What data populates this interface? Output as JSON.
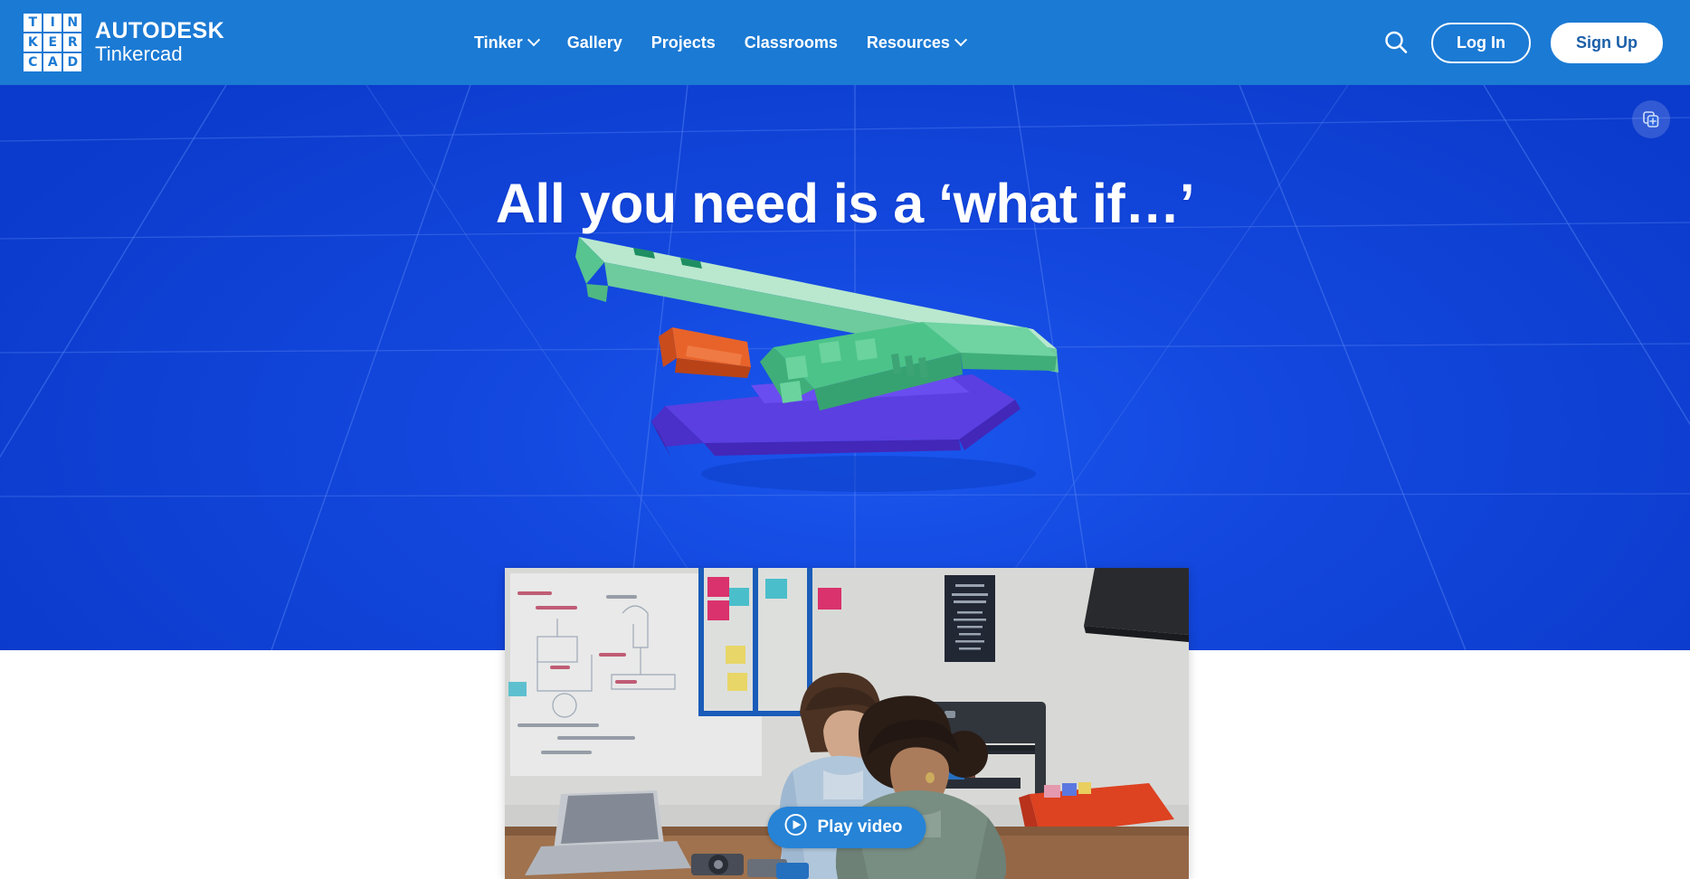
{
  "brand": {
    "logo_tiles": [
      "T",
      "I",
      "N",
      "K",
      "E",
      "R",
      "C",
      "A",
      "D"
    ],
    "logo_icon_name": "tinkercad-logo-icon",
    "company": "AUTODESK",
    "product": "Tinkercad"
  },
  "header": {
    "background_color": "#1b7ad4",
    "nav": [
      {
        "label": "Tinker",
        "has_dropdown": true
      },
      {
        "label": "Gallery",
        "has_dropdown": false
      },
      {
        "label": "Projects",
        "has_dropdown": false
      },
      {
        "label": "Classrooms",
        "has_dropdown": false
      },
      {
        "label": "Resources",
        "has_dropdown": true
      }
    ],
    "search_icon": "search-icon",
    "login_label": "Log In",
    "signup_label": "Sign Up",
    "signup_text_color": "#1b5fa8"
  },
  "hero": {
    "headline": "All you need is a ‘what if…’",
    "background_color": "#1144d8",
    "accent_green": "#5ecf9b",
    "accent_orange": "#e8632a",
    "accent_purple": "#5b3fe0",
    "floating_button_icon": "copy-add-icon"
  },
  "video": {
    "play_label": "Play video",
    "play_icon": "play-circle-icon",
    "button_color": "#2683d6"
  }
}
